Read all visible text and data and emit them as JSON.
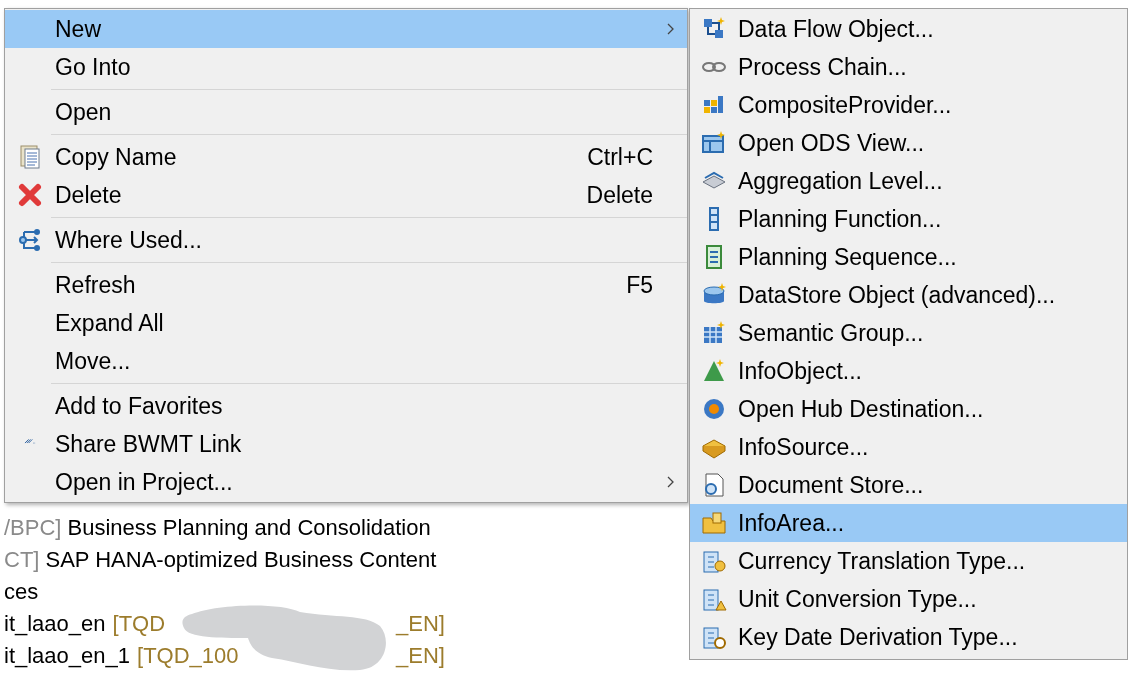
{
  "tree": [
    {
      "prefix": "/BPC]",
      "label": "Business Planning and Consolidation"
    },
    {
      "prefix": "CT]",
      "label": "SAP HANA-optimized Business Content"
    },
    {
      "label": "ces"
    },
    {
      "label": "it_laao_en",
      "tag": "[TQD",
      "tag_end": "_EN]",
      "redacted": true
    },
    {
      "label": "it_laao_en_1",
      "tag": "[TQD_100",
      "tag_end": "_EN]",
      "redacted": true
    }
  ],
  "context_menu": {
    "items": [
      {
        "kind": "item",
        "label": "New",
        "selected": true,
        "submenu": true
      },
      {
        "kind": "item",
        "label": "Go Into",
        "selected": false
      },
      {
        "kind": "separator"
      },
      {
        "kind": "item",
        "label": "Open",
        "selected": false
      },
      {
        "kind": "separator"
      },
      {
        "kind": "item",
        "label": "Copy Name",
        "shortcut": "Ctrl+C",
        "selected": false
      },
      {
        "kind": "item",
        "label": "Delete",
        "shortcut": "Delete",
        "selected": false
      },
      {
        "kind": "separator"
      },
      {
        "kind": "item",
        "label": "Where Used...",
        "selected": false
      },
      {
        "kind": "separator"
      },
      {
        "kind": "item",
        "label": "Refresh",
        "shortcut": "F5",
        "selected": false
      },
      {
        "kind": "item",
        "label": "Expand All",
        "selected": false
      },
      {
        "kind": "item",
        "label": "Move...",
        "selected": false
      },
      {
        "kind": "separator"
      },
      {
        "kind": "item",
        "label": "Add to Favorites",
        "selected": false
      },
      {
        "kind": "item",
        "label": "Share BWMT Link",
        "selected": false
      },
      {
        "kind": "item",
        "label": "Open in Project...",
        "selected": false,
        "submenu": true
      }
    ]
  },
  "submenu": {
    "items": [
      {
        "label": "Data Flow Object...",
        "selected": false
      },
      {
        "label": "Process Chain...",
        "selected": false
      },
      {
        "label": "CompositeProvider...",
        "selected": false
      },
      {
        "label": "Open ODS View...",
        "selected": false
      },
      {
        "label": "Aggregation Level...",
        "selected": false
      },
      {
        "label": "Planning Function...",
        "selected": false
      },
      {
        "label": "Planning Sequence...",
        "selected": false
      },
      {
        "label": "DataStore Object (advanced)...",
        "selected": false
      },
      {
        "label": "Semantic Group...",
        "selected": false
      },
      {
        "label": "InfoObject...",
        "selected": false
      },
      {
        "label": "Open Hub Destination...",
        "selected": false
      },
      {
        "label": "InfoSource...",
        "selected": false
      },
      {
        "label": "Document Store...",
        "selected": false
      },
      {
        "label": "InfoArea...",
        "selected": true
      },
      {
        "label": "Currency Translation Type...",
        "selected": false
      },
      {
        "label": "Unit Conversion Type...",
        "selected": false
      },
      {
        "label": "Key Date Derivation Type...",
        "selected": false
      }
    ]
  }
}
